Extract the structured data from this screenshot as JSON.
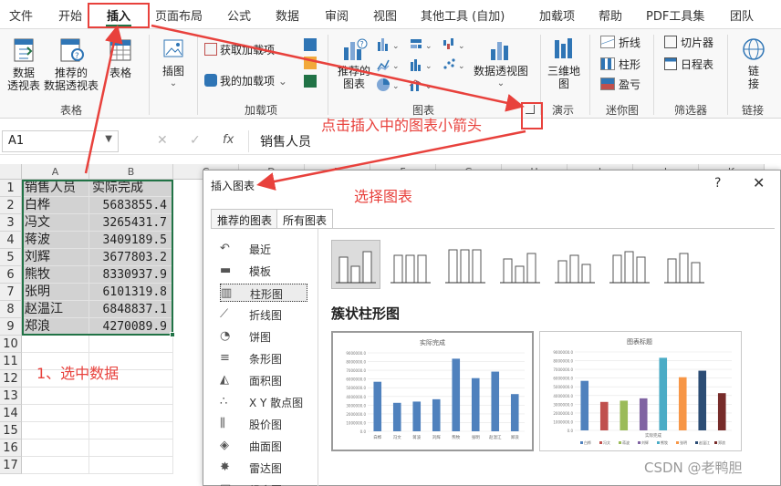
{
  "menu": {
    "tabs": [
      "文件",
      "开始",
      "插入",
      "页面布局",
      "公式",
      "数据",
      "审阅",
      "视图",
      "其他工具 (自加)",
      "加载项",
      "帮助",
      "PDF工具集",
      "团队"
    ],
    "active": "插入"
  },
  "ribbon": {
    "pivot": "数据\n透视表",
    "recommended_pivot": "推荐的\n数据透视表",
    "table": "表格",
    "group_tables": "表格",
    "illustration": "插图",
    "get_addins": "获取加载项",
    "my_addins": "我的加载项",
    "group_addins": "加载项",
    "recommended_charts": "推荐的\n图表",
    "pivot_chart": "数据透视图",
    "group_charts": "图表",
    "map3d": "三维地\n图",
    "group_demo": "演示",
    "spark_line": "折线",
    "spark_column": "柱形",
    "spark_winloss": "盈亏",
    "group_spark": "迷你图",
    "slicer": "切片器",
    "timeline": "日程表",
    "group_filter": "筛选器",
    "link": "链\n接",
    "group_link": "链接"
  },
  "formula_bar": {
    "name_box": "A1",
    "content": "销售人员",
    "fx": "fx"
  },
  "sheet": {
    "columns": [
      "A",
      "B",
      "C",
      "D",
      "E",
      "F",
      "G",
      "H",
      "I",
      "J",
      "K"
    ],
    "rows": [
      "1",
      "2",
      "3",
      "4",
      "5",
      "6",
      "7",
      "8",
      "9",
      "10",
      "11",
      "12",
      "13",
      "14",
      "15",
      "16",
      "17"
    ],
    "header": [
      "销售人员",
      "实际完成"
    ],
    "data": [
      {
        "name": "白桦",
        "value": "5683855.4"
      },
      {
        "name": "冯文",
        "value": "3265431.7"
      },
      {
        "name": "蒋波",
        "value": "3409189.5"
      },
      {
        "name": "刘辉",
        "value": "3677803.2"
      },
      {
        "name": "熊牧",
        "value": "8330937.9"
      },
      {
        "name": "张明",
        "value": "6101319.8"
      },
      {
        "name": "赵温江",
        "value": "6848837.1"
      },
      {
        "name": "郑浪",
        "value": "4270089.9"
      }
    ]
  },
  "dialog": {
    "title": "插入图表",
    "help": "?",
    "close": "✕",
    "tabs": [
      "推荐的图表",
      "所有图表"
    ],
    "active_tab": "所有图表",
    "categories": [
      "最近",
      "模板",
      "柱形图",
      "折线图",
      "饼图",
      "条形图",
      "面积图",
      "X Y 散点图",
      "股价图",
      "曲面图",
      "雷达图",
      "组合图"
    ],
    "selected_category": "柱形图",
    "chart_type_name": "簇状柱形图",
    "preview1": {
      "title": "实际完成",
      "names": [
        "白桦",
        "冯文",
        "蒋波",
        "刘辉",
        "熊牧",
        "张明",
        "赵温江",
        "郑浪"
      ],
      "values": [
        5683855.4,
        3265431.7,
        3409189.5,
        3677803.2,
        8330937.9,
        6101319.8,
        6848837.1,
        4270089.9
      ],
      "ticks": [
        "0.0",
        "1000000.0",
        "2000000.0",
        "3000000.0",
        "4000000.0",
        "5000000.0",
        "6000000.0",
        "7000000.0",
        "8000000.0",
        "9000000.0"
      ],
      "color": "#4f81bd"
    },
    "preview2": {
      "title": "图表标题",
      "xlabel": "实际完成",
      "colors": [
        "#4f81bd",
        "#c0504d",
        "#9bbb59",
        "#8064a2",
        "#4bacc6",
        "#f79646",
        "#2c4d75",
        "#772c2a"
      ]
    }
  },
  "annotations": {
    "step1": "1、选中数据",
    "click_arrow": "点击插入中的图表小箭头",
    "select_chart": "选择图表",
    "color": "#e8413c"
  },
  "watermark": "CSDN @老鸭胆"
}
